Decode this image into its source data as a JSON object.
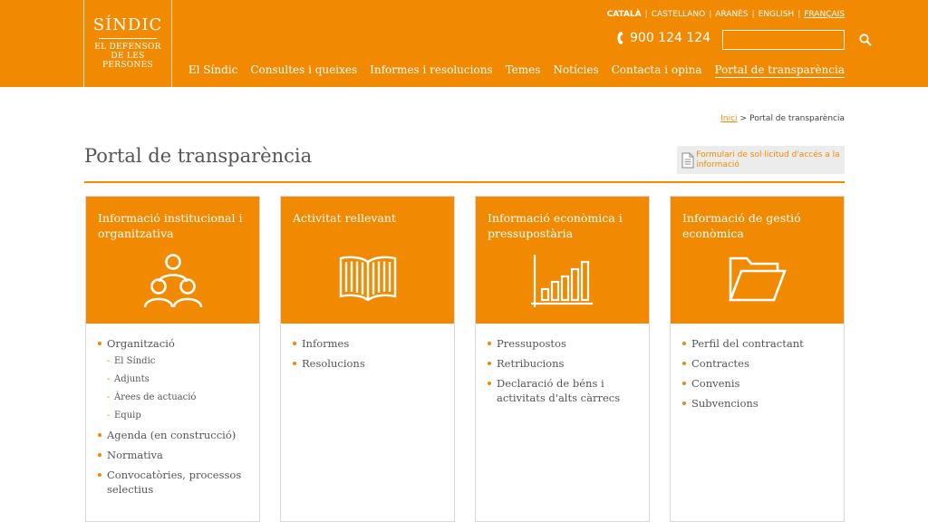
{
  "logo": {
    "title": "SÍNDIC",
    "subtitle": [
      "EL DEFENSOR",
      "DE LES",
      "PERSONES"
    ]
  },
  "languages": [
    {
      "label": "CATALÀ"
    },
    {
      "label": "CASTELLANO"
    },
    {
      "label": "ARANÉS"
    },
    {
      "label": "ENGLISH"
    },
    {
      "label": "FRANÇAIS"
    }
  ],
  "phone": {
    "number": "900 124 124",
    "icon": "phone-icon"
  },
  "search": {
    "value": "",
    "placeholder": "",
    "icon": "search-icon"
  },
  "nav": [
    {
      "label": "El Síndic"
    },
    {
      "label": "Consultes i queixes"
    },
    {
      "label": "Informes i resolucions"
    },
    {
      "label": "Temes"
    },
    {
      "label": "Notícies"
    },
    {
      "label": "Contacta i opina"
    },
    {
      "label": "Portal de transparència"
    }
  ],
  "breadcrumb": {
    "home": "Inici",
    "separator": ">",
    "current": "Portal de transparència"
  },
  "page_title": "Portal de transparència",
  "form_link": {
    "label": "Formulari de sol·licitud d'accés a la informació",
    "icon": "document-icon"
  },
  "colors": {
    "accent": "#f18a00",
    "text": "#555555",
    "form_bg": "#ececec"
  },
  "cards": [
    {
      "title": "Informació institucional i organitzativa",
      "icon": "people-icon",
      "items": [
        {
          "label": "Organització",
          "sub": [
            "El Síndic",
            "Adjunts",
            "Àrees de actuació",
            "Equip"
          ]
        },
        {
          "label": "Agenda (en construcció)"
        },
        {
          "label": "Normativa"
        },
        {
          "label": "Convocatòries, processos selectius"
        }
      ]
    },
    {
      "title": "Activitat rellevant",
      "icon": "open-book-icon",
      "items": [
        {
          "label": "Informes"
        },
        {
          "label": "Resolucions"
        }
      ]
    },
    {
      "title": "Informació econòmica i pressupostària",
      "icon": "bar-chart-icon",
      "items": [
        {
          "label": "Pressupostos"
        },
        {
          "label": "Retribucions"
        },
        {
          "label": "Declaració de béns i activitats d'alts càrrecs"
        }
      ]
    },
    {
      "title": "Informació de gestió econòmica",
      "icon": "folder-icon",
      "items": [
        {
          "label": "Perfil del contractant"
        },
        {
          "label": "Contractes"
        },
        {
          "label": "Convenis"
        },
        {
          "label": "Subvencions"
        }
      ]
    }
  ]
}
